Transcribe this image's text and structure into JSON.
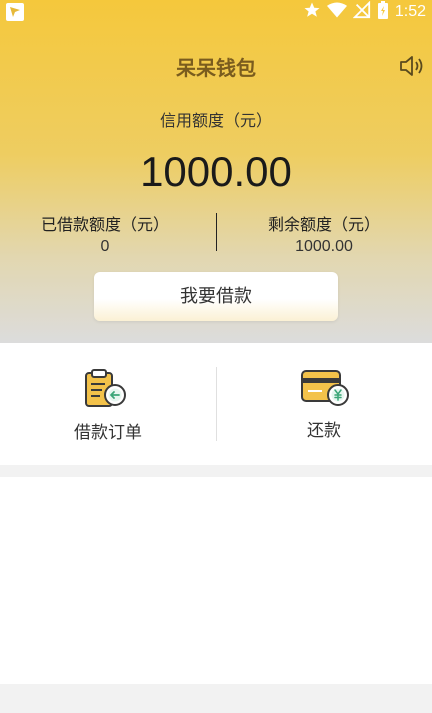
{
  "status_bar": {
    "time": "1:52"
  },
  "header": {
    "title": "呆呆钱包",
    "credit_label": "信用额度（元）",
    "credit_value": "1000.00",
    "borrowed_label": "已借款额度（元）",
    "borrowed_value": "0",
    "remaining_label": "剩余额度（元）",
    "remaining_value": "1000.00",
    "borrow_button_label": "我要借款"
  },
  "actions": {
    "orders_label": "借款订单",
    "repay_label": "还款"
  },
  "colors": {
    "accent": "#f5c83c",
    "title": "#7a5c1e"
  },
  "icons": [
    "speaker-icon",
    "order-clipboard-icon",
    "repay-card-icon",
    "star-icon",
    "wifi-icon",
    "battery-icon"
  ]
}
